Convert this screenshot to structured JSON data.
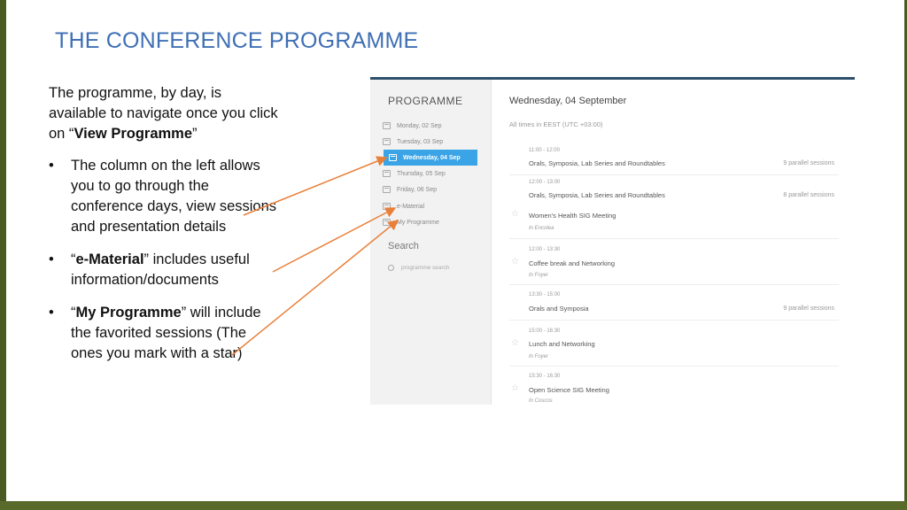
{
  "slide": {
    "title": "THE CONFERENCE PROGRAMME",
    "intro_pre": "The programme, by day, is available to navigate once you click on “",
    "intro_bold": "View Programme",
    "intro_post": "”",
    "bullet1": "The column on the left allows you to go through the conference days, view sessions and presentation details",
    "bullet2_pre": "“",
    "bullet2_bold": "e-Material",
    "bullet2_post": "” includes useful information/documents",
    "bullet3_pre": "“",
    "bullet3_bold": "My Programme",
    "bullet3_post": "” will include the favorited sessions (The ones you mark with a star)"
  },
  "sidebar": {
    "title": "PROGRAMME",
    "items": [
      {
        "label": "Monday, 02 Sep"
      },
      {
        "label": "Tuesday, 03 Sep"
      },
      {
        "label": "Wednesday, 04 Sep"
      },
      {
        "label": "Thursday, 05 Sep"
      },
      {
        "label": "Friday, 06 Sep"
      },
      {
        "label": "e-Material"
      },
      {
        "label": "My Programme"
      }
    ],
    "active_index": 2,
    "search_heading": "Search",
    "search_placeholder": "programme search"
  },
  "main": {
    "day_heading": "Wednesday, 04 September",
    "timezone": "All times in EEST (UTC +03:00)",
    "sessions": [
      {
        "time": "11:00 - 12:00",
        "name": "Orals, Symposia, Lab Series and Roundtables",
        "parallel": "9 parallel sessions"
      },
      {
        "time": "12:00 - 13:00",
        "name": "Orals, Symposia, Lab Series and Roundtables",
        "parallel": "8 parallel sessions"
      },
      {
        "name": "Women's Health SIG Meeting",
        "location": "In Encolea",
        "starred": true
      },
      {
        "time": "12:00 - 13:30",
        "name": "Coffee break and Networking",
        "location": "In Foyer",
        "starred": true
      },
      {
        "time": "13:30 - 15:00",
        "name": "Orals and Symposia",
        "parallel": "9 parallel sessions"
      },
      {
        "time": "15:00 - 16:30",
        "name": "Lunch and Networking",
        "location": "In Foyer",
        "starred": true
      },
      {
        "time": "15:30 - 16:30",
        "name": "Open Science SIG Meeting",
        "location": "In Coscos",
        "starred": true
      }
    ]
  },
  "icons": {
    "calendar": "calendar-icon",
    "star": "star-icon",
    "search": "search-icon"
  },
  "colors": {
    "title": "#3f6fb5",
    "active_item": "#3aa4e6",
    "arrow": "#e8803a",
    "frame": "#4a5a22"
  }
}
